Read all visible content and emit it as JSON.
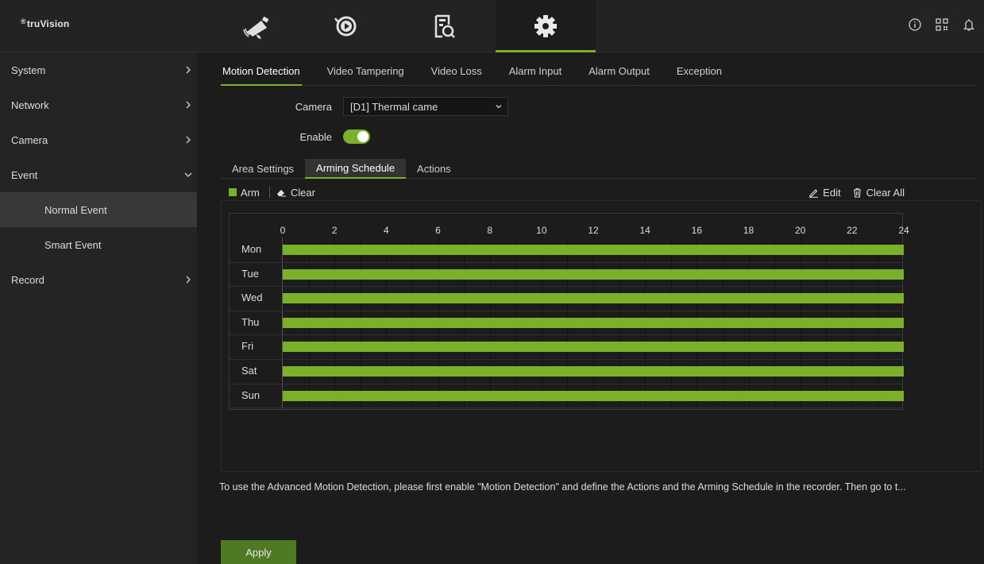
{
  "app": {
    "logo_text": "truVision",
    "logo_mark": "®"
  },
  "topnav": {
    "tabs": [
      {
        "icon": "camera-icon",
        "active": false
      },
      {
        "icon": "playback-icon",
        "active": false
      },
      {
        "icon": "search-file-icon",
        "active": false
      },
      {
        "icon": "gear-icon",
        "active": true
      }
    ],
    "right_icons": [
      "info-icon",
      "qr-code-icon",
      "bell-icon"
    ]
  },
  "sidebar": {
    "items": [
      {
        "label": "System",
        "chevron": ">"
      },
      {
        "label": "Network",
        "chevron": ">"
      },
      {
        "label": "Camera",
        "chevron": ">"
      },
      {
        "label": "Event",
        "chevron": "v"
      },
      {
        "label": "Record",
        "chevron": ">"
      }
    ],
    "event_sub": [
      {
        "label": "Normal Event",
        "active": true
      },
      {
        "label": "Smart Event",
        "active": false
      }
    ]
  },
  "event_tabs": [
    "Motion Detection",
    "Video Tampering",
    "Video Loss",
    "Alarm Input",
    "Alarm Output",
    "Exception"
  ],
  "form": {
    "camera_label": "Camera",
    "camera_value": "[D1] Thermal came",
    "enable_label": "Enable",
    "enable_on": true
  },
  "sub_tabs": [
    "Area Settings",
    "Arming Schedule",
    "Actions"
  ],
  "toolbar": {
    "arm_label": "Arm",
    "clear_label": "Clear",
    "edit_label": "Edit",
    "clear_all_label": "Clear All"
  },
  "schedule": {
    "hours": [
      "0",
      "2",
      "4",
      "6",
      "8",
      "10",
      "12",
      "14",
      "16",
      "18",
      "20",
      "22",
      "24"
    ],
    "days": [
      "Mon",
      "Tue",
      "Wed",
      "Thu",
      "Fri",
      "Sat",
      "Sun"
    ],
    "armed_range_hours": [
      0,
      24
    ]
  },
  "notice": "To use the Advanced Motion Detection, please first enable \"Motion Detection\" and define the Actions and the Arming Schedule in the recorder. Then go to t...",
  "apply_label": "Apply",
  "colors": {
    "accent": "#7ab02a",
    "background": "#1c1c1c",
    "sidebar": "#242424"
  }
}
